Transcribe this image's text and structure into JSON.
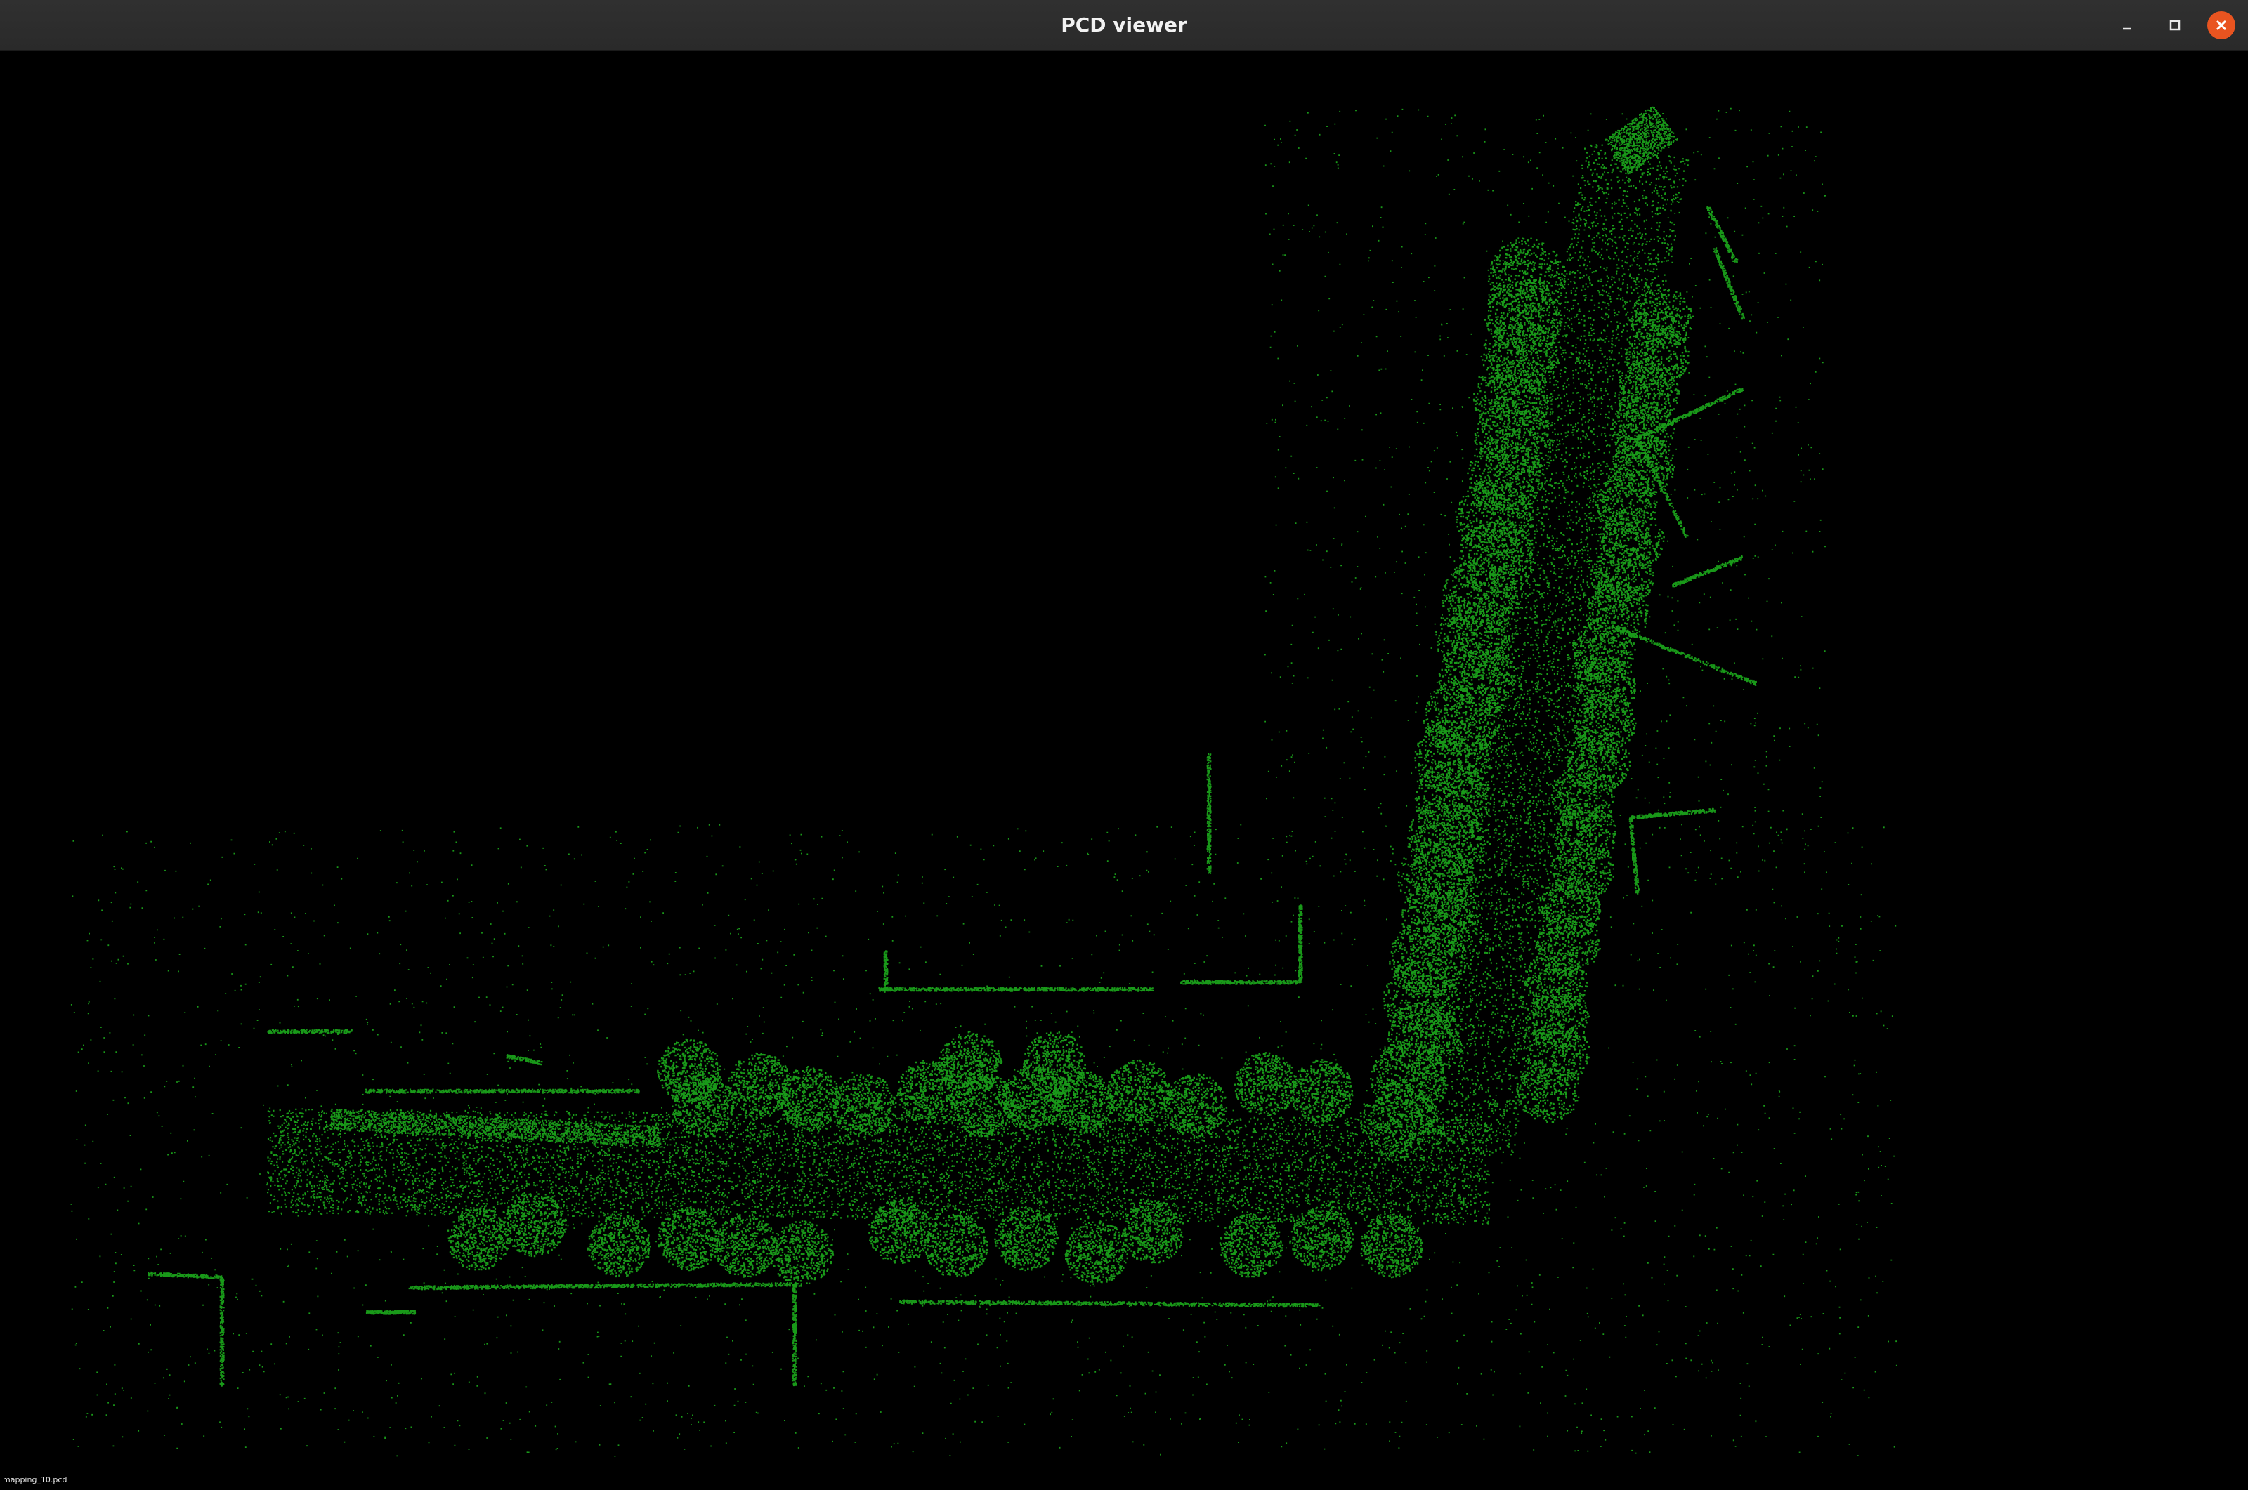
{
  "window": {
    "title": "PCD viewer",
    "controls": [
      {
        "name": "minimize",
        "icon": "minimize-icon"
      },
      {
        "name": "maximize",
        "icon": "maximize-icon"
      },
      {
        "name": "close",
        "icon": "close-icon"
      }
    ]
  },
  "viewer": {
    "background_color": "#000000",
    "point_color": "#22cc22",
    "status_text": "mapping_10.pcd"
  },
  "colors": {
    "titlebar": "#2c2c2c",
    "close_button": "#e95420"
  }
}
